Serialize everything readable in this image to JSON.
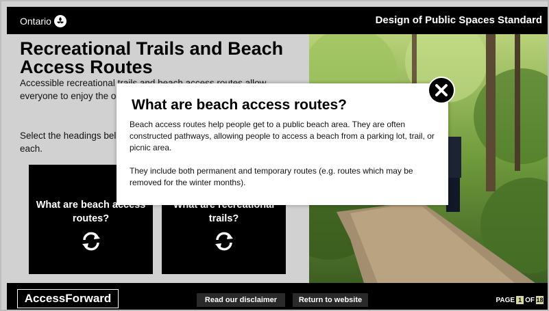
{
  "header": {
    "brand": "Ontario",
    "standard_title": "Design of Public Spaces Standard"
  },
  "main": {
    "title": "Recreational Trails and Beach Access Routes",
    "intro": "Accessible recreational trails and beach access routes allow everyone to enjoy the outdoors, including people with disabilities.",
    "instruction": "Select the headings below to learn which requirement applies to each.",
    "cards": [
      {
        "label": "What are beach access routes?",
        "icon": "flip-arrows-icon"
      },
      {
        "label": "What are recreational trails?",
        "icon": "flip-arrows-icon"
      }
    ]
  },
  "modal": {
    "title": "What are beach access routes?",
    "p1": "Beach access routes help people get to a public beach area. They are often constructed pathways, allowing people to access a beach from a parking lot, trail, or picnic area.",
    "p2": "They include both permanent and temporary routes (e.g. routes which may be removed for the winter months).",
    "close_icon": "close-icon"
  },
  "footer": {
    "brand": "AccessForward",
    "disclaimer": "Read our disclaimer",
    "return": "Return to website",
    "page_label": "PAGE",
    "page_current": "1",
    "page_of": "OF",
    "page_total": "18"
  },
  "colors": {
    "bar": "#000000",
    "panel": "#d1d1d1",
    "page_box": "#d8d8a0"
  }
}
